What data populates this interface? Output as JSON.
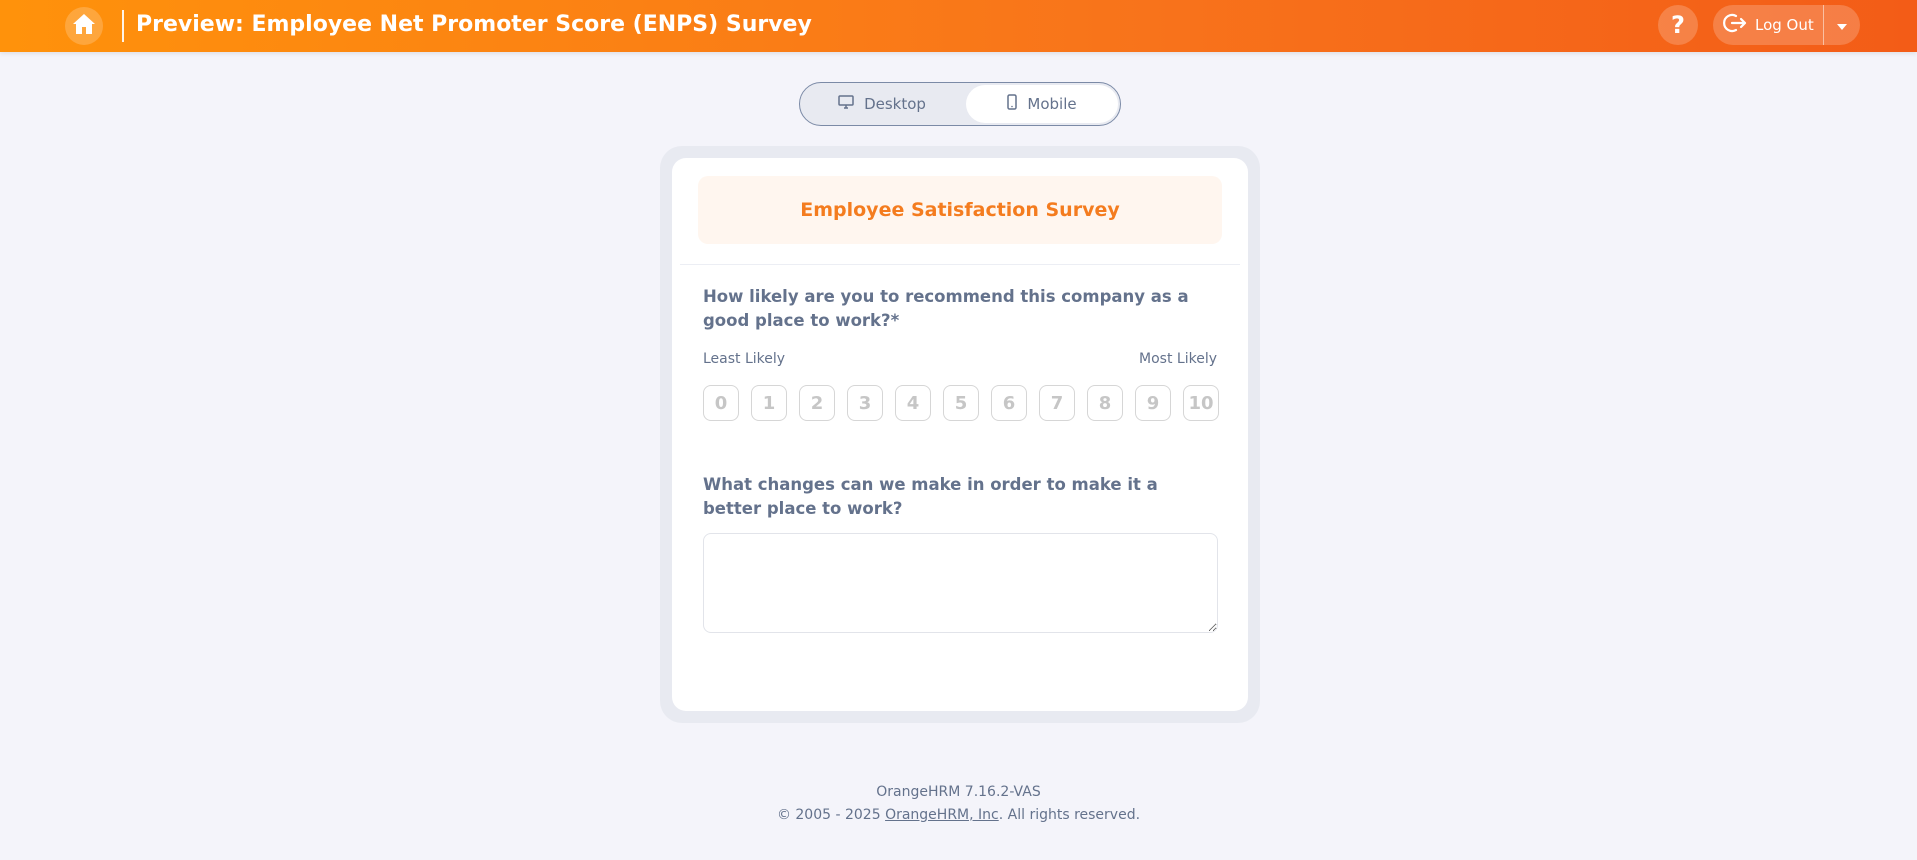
{
  "header": {
    "title": "Preview: Employee Net Promoter Score (ENPS) Survey",
    "help_label": "?",
    "logout_label": "Log Out",
    "home_icon": "home-icon",
    "logout_icon": "logout-icon",
    "colors": {
      "gradient_start": "#ff920b",
      "gradient_end": "#f35c17"
    }
  },
  "view_toggle": {
    "desktop_label": "Desktop",
    "mobile_label": "Mobile",
    "selected": "Mobile"
  },
  "survey": {
    "title": "Employee Satisfaction Survey",
    "question1": {
      "text": "How likely are you to recommend this company as a good place to work?*",
      "least_label": "Least Likely",
      "most_label": "Most Likely",
      "scale": [
        "0",
        "1",
        "2",
        "3",
        "4",
        "5",
        "6",
        "7",
        "8",
        "9",
        "10"
      ]
    },
    "question2": {
      "text": "What changes can we make in order to make it a better place to work?",
      "answer_value": ""
    }
  },
  "footer": {
    "version": "OrangeHRM 7.16.2-VAS",
    "copyright_prefix": "© 2005 - 2025 ",
    "company_link": "OrangeHRM, Inc",
    "copyright_suffix": ". All rights reserved."
  }
}
